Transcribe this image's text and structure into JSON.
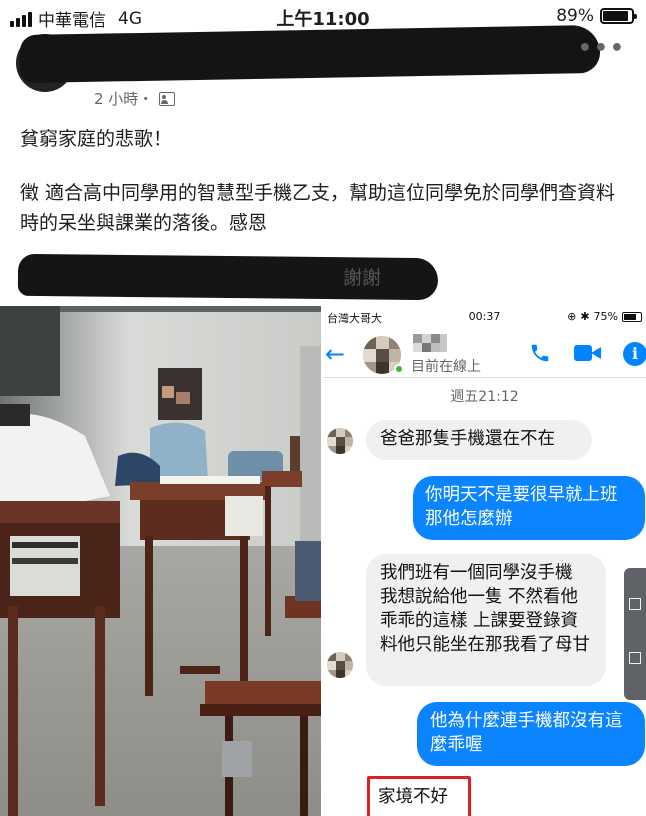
{
  "status_bar": {
    "carrier": "中華電信",
    "network": "4G",
    "time": "上午11:00",
    "battery_text": "89%",
    "battery_level": 0.89
  },
  "post": {
    "time_meta": "2 小時・",
    "line1": "貧窮家庭的悲歌！",
    "line2": "徵 適合高中同學用的智慧型手機乙支，幫助這位同學免於同學們查資料時的呆坐與課業的落後。感恩",
    "thanks": "謝謝",
    "more_icon": "more-horizontal-icon",
    "audience_icon": "friends-audience-icon"
  },
  "messenger": {
    "status": {
      "carrier": "台灣大哥大",
      "time": "00:37",
      "battery_text": "75%",
      "battery_level": 0.75
    },
    "header": {
      "status_text": "目前在線上",
      "accent_color": "#0084ff"
    },
    "date_label": "週五21:12",
    "messages": [
      {
        "side": "in",
        "text": "爸爸那隻手機還在不在"
      },
      {
        "side": "out",
        "text": "你明天不是要很早就上班那他怎麼辦"
      },
      {
        "side": "in",
        "text": "我們班有一個同學沒手機 我想說給他一隻 不然看他乖乖的這樣 上課要登錄資料他只能坐在那我看了母甘"
      },
      {
        "side": "out",
        "text": "他為什麼連手機都沒有這麼乖喔"
      },
      {
        "side": "in",
        "text": "家境不好"
      }
    ]
  }
}
